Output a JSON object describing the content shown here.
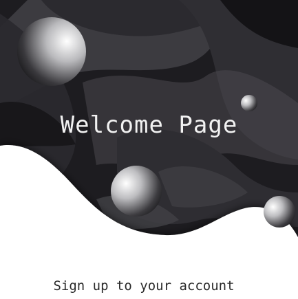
{
  "welcome": {
    "title": "Welcome Page"
  },
  "signup": {
    "label": "Sign up to your account"
  },
  "colors": {
    "background_dark": "#1b1a1d",
    "panel": "#ffffff",
    "title_text": "#f2f2f2",
    "signup_text": "#2b2b2b"
  },
  "icons": [
    "sphere-large",
    "sphere-small",
    "sphere-middle",
    "sphere-right"
  ]
}
